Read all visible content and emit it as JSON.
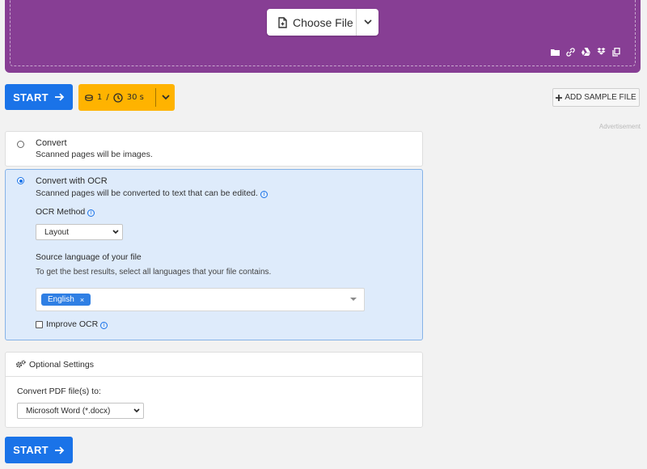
{
  "upload": {
    "choose_label": "Choose File",
    "bg_color": "#873e94",
    "source_icons": [
      "folder-icon",
      "link-icon",
      "google-drive-icon",
      "dropbox-icon",
      "clipboard-icon"
    ]
  },
  "toolbar": {
    "start_label": "START",
    "credits": "1",
    "credit_separator": "/",
    "time": "30 s",
    "add_sample_label": "ADD SAMPLE FILE",
    "advertisement": "Advertisement",
    "accent_color": "#1a73e8",
    "credit_color": "#ffb300"
  },
  "options": {
    "convert": {
      "title": "Convert",
      "description": "Scanned pages will be images.",
      "selected": false
    },
    "convert_ocr": {
      "title": "Convert with OCR",
      "description": "Scanned pages will be converted to text that can be edited.",
      "selected": true,
      "ocr_method_label": "OCR Method",
      "ocr_method_value": "Layout",
      "source_language_label": "Source language of your file",
      "source_language_hint": "To get the best results, select all languages that your file contains.",
      "selected_languages": [
        "English"
      ],
      "improve_ocr_label": "Improve OCR",
      "improve_ocr_checked": false
    }
  },
  "optional_settings": {
    "title": "Optional Settings",
    "convert_to_label": "Convert PDF file(s) to:",
    "convert_to_value": "Microsoft Word (*.docx)"
  },
  "footer": {
    "start_label": "START"
  }
}
